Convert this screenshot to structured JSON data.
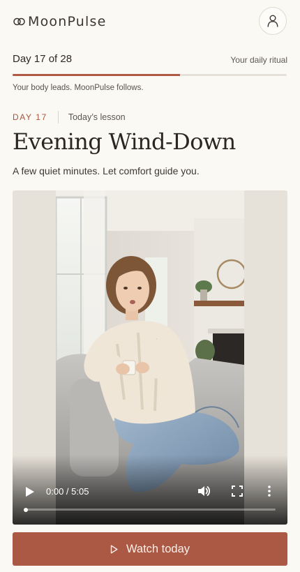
{
  "header": {
    "app_name": "MoonPulse",
    "logo_icon": "moon-rings-icon",
    "profile_icon": "user-icon"
  },
  "progress": {
    "day_text": "Day 17 of 28",
    "ritual_label": "Your daily ritual",
    "current_day": 17,
    "total_days": 28,
    "fill_fraction": 0.61,
    "tagline": "Your body leads. MoonPulse follows."
  },
  "lesson": {
    "day_tag": "DAY 17",
    "label": "Today’s lesson",
    "title": "Evening Wind-Down",
    "subtitle": "A few quiet minutes. Let comfort guide you."
  },
  "video": {
    "time_display": "0:00 / 5:05",
    "played_fraction": 0.0,
    "icons": [
      "play-icon",
      "volume-icon",
      "fullscreen-icon",
      "more-vert-icon"
    ]
  },
  "cta": {
    "label": "Watch today",
    "icon": "play-outline-icon"
  },
  "colors": {
    "background": "#fbf9f4",
    "accent": "#ab5844",
    "text": "#2a2522"
  }
}
